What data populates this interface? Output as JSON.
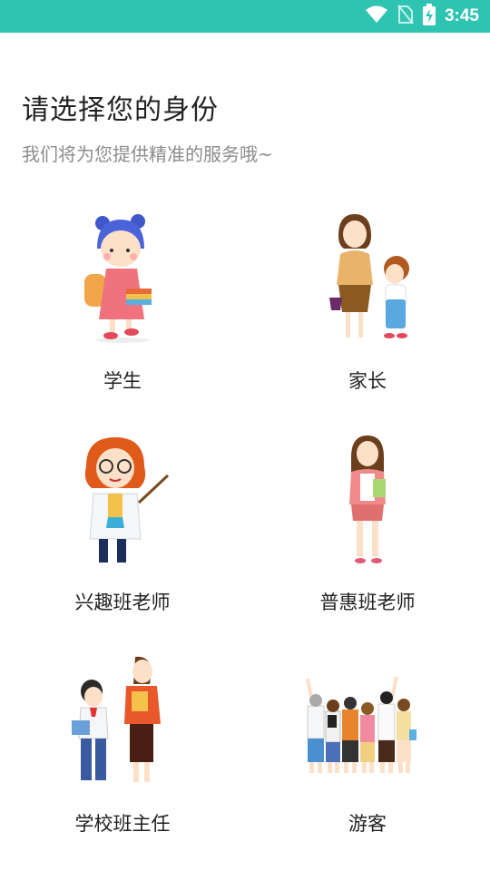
{
  "status_bar": {
    "time": "3:45",
    "icons": [
      "wifi-icon",
      "no-sim-icon",
      "battery-charging-icon"
    ],
    "background_color": "#2fc4b2"
  },
  "header": {
    "title": "请选择您的身份",
    "subtitle": "我们将为您提供精准的服务哦~"
  },
  "roles": [
    {
      "label": "学生",
      "icon": "student-girl-illustration"
    },
    {
      "label": "家长",
      "icon": "parent-with-child-illustration"
    },
    {
      "label": "兴趣班老师",
      "icon": "interest-class-teacher-illustration"
    },
    {
      "label": "普惠班老师",
      "icon": "public-class-teacher-illustration"
    },
    {
      "label": "学校班主任",
      "icon": "head-teacher-illustration"
    },
    {
      "label": "游客",
      "icon": "tourists-group-illustration"
    }
  ]
}
